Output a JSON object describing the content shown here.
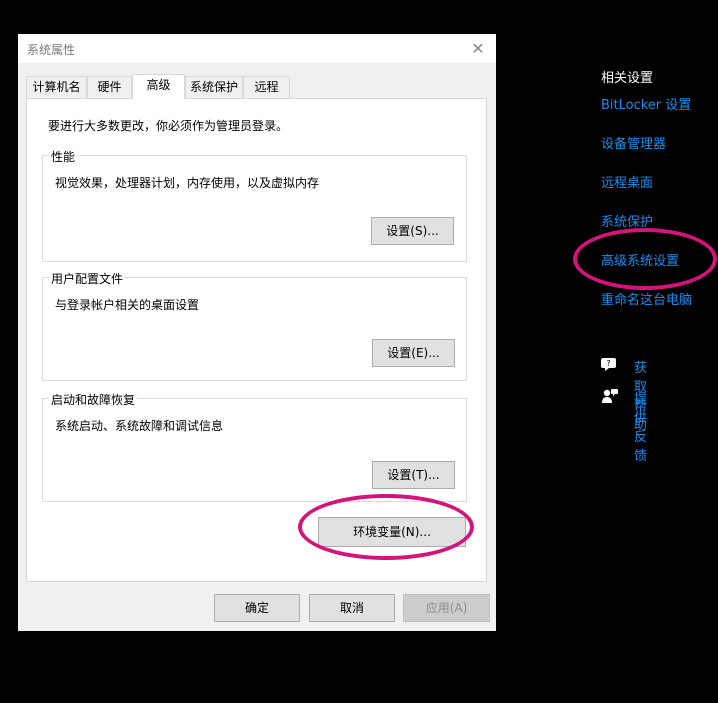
{
  "dialog": {
    "title": "系统属性",
    "close_glyph": "✕",
    "tabs": [
      {
        "label": "计算机名"
      },
      {
        "label": "硬件"
      },
      {
        "label": "高级"
      },
      {
        "label": "系统保护"
      },
      {
        "label": "远程"
      }
    ],
    "active_tab": "高级",
    "admin_note": "要进行大多数更改，你必须作为管理员登录。",
    "groups": {
      "performance": {
        "title": "性能",
        "description": "视觉效果，处理器计划，内存使用，以及虚拟内存",
        "button": "设置(S)..."
      },
      "user_profiles": {
        "title": "用户配置文件",
        "description": "与登录帐户相关的桌面设置",
        "button": "设置(E)..."
      },
      "startup_recovery": {
        "title": "启动和故障恢复",
        "description": "系统启动、系统故障和调试信息",
        "button": "设置(T)..."
      }
    },
    "env_button": "环境变量(N)...",
    "footer": {
      "ok": "确定",
      "cancel": "取消",
      "apply": "应用(A)"
    }
  },
  "related_settings": {
    "heading": "相关设置",
    "links": [
      {
        "label": "BitLocker 设置"
      },
      {
        "label": "设备管理器"
      },
      {
        "label": "远程桌面"
      },
      {
        "label": "系统保护"
      },
      {
        "label": "高级系统设置"
      },
      {
        "label": "重命名这台电脑"
      }
    ],
    "help": {
      "get_help": "获取帮助",
      "feedback": "提供反馈"
    }
  },
  "colors": {
    "link": "#1a8ef0",
    "highlight_circle": "#d4147a",
    "background": "#000000"
  }
}
